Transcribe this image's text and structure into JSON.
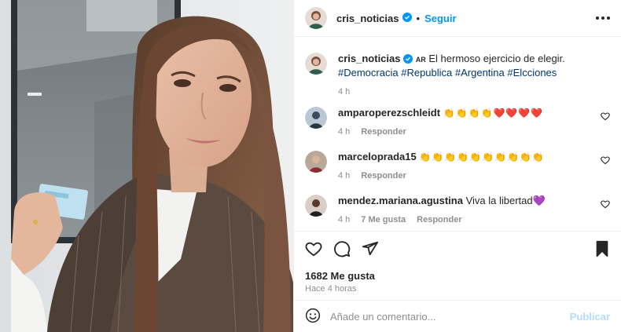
{
  "header": {
    "username": "cris_noticias",
    "separator": "•",
    "follow_label": "Seguir"
  },
  "caption": {
    "username": "cris_noticias",
    "flag": "AR",
    "text": "El hermoso ejercicio de elegir.",
    "hashtags": [
      "#Democracia",
      "#Republica",
      "#Argentina",
      "#Elcciones"
    ],
    "time": "4 h"
  },
  "comments": [
    {
      "username": "amparoperezschleidt",
      "text": "👏👏👏👏❤️❤️❤️❤️",
      "time": "4 h",
      "likes": "",
      "reply_label": "Responder"
    },
    {
      "username": "marceloprada15",
      "text": "👏👏👏👏👏👏👏👏👏👏",
      "time": "4 h",
      "likes": "",
      "reply_label": "Responder"
    },
    {
      "username": "mendez.mariana.agustina",
      "text": "Viva la libertad💜",
      "time": "4 h",
      "likes": "7 Me gusta",
      "reply_label": "Responder"
    }
  ],
  "likes_count": "1682 Me gusta",
  "post_time": "Hace 4 horas",
  "composer": {
    "placeholder": "Añade un comentario...",
    "publish_label": "Publicar"
  },
  "icons": {
    "like": "heart-icon",
    "comment": "comment-icon",
    "share": "share-icon",
    "save": "bookmark-icon",
    "emoji": "emoji-icon",
    "more": "more-icon"
  },
  "colors": {
    "accent": "#0095f6",
    "hashtag": "#00376b",
    "muted": "#8e8e8e",
    "publish_disabled": "#b3dbff"
  }
}
